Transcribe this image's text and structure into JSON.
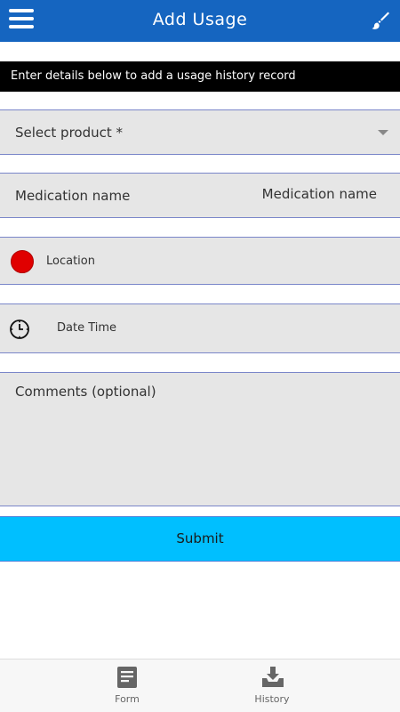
{
  "header": {
    "title": "Add Usage",
    "menu_icon": "hamburger-menu-icon",
    "action_icon": "paint-brush-icon",
    "background": "#1565c0"
  },
  "banner": {
    "text": "Enter details below to add a usage history record"
  },
  "form": {
    "product": {
      "placeholder": "Select product *"
    },
    "medication": {
      "label": "Medication name",
      "value": "Medication name"
    },
    "location": {
      "label": "Location",
      "status_color": "#e00000"
    },
    "datetime": {
      "label": "Date Time",
      "icon": "clock-icon"
    },
    "comments": {
      "label": "Comments (optional)"
    },
    "submit_label": "Submit",
    "submit_color": "#00bfff"
  },
  "bottom_nav": {
    "items": [
      {
        "label": "Form",
        "icon": "form-icon"
      },
      {
        "label": "History",
        "icon": "download-tray-icon"
      }
    ]
  }
}
